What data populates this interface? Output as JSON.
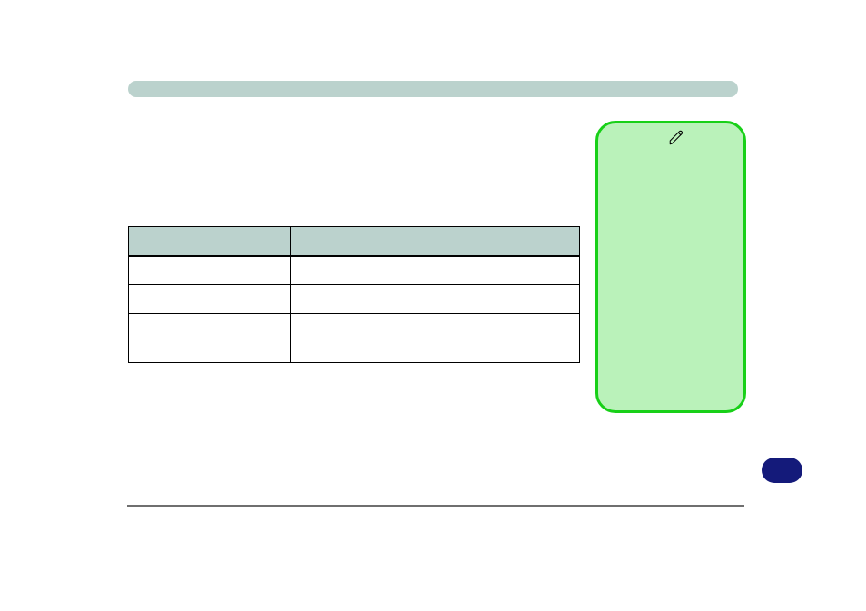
{
  "header": {
    "title": ""
  },
  "note": {
    "icon_name": "pen-icon",
    "text": ""
  },
  "table": {
    "headers": [
      "",
      ""
    ],
    "rows": [
      {
        "cells": [
          "",
          ""
        ],
        "tall": false
      },
      {
        "cells": [
          "",
          ""
        ],
        "tall": false
      },
      {
        "cells": [
          "",
          ""
        ],
        "tall": true
      }
    ]
  },
  "pill": {
    "label": ""
  },
  "divider": true
}
